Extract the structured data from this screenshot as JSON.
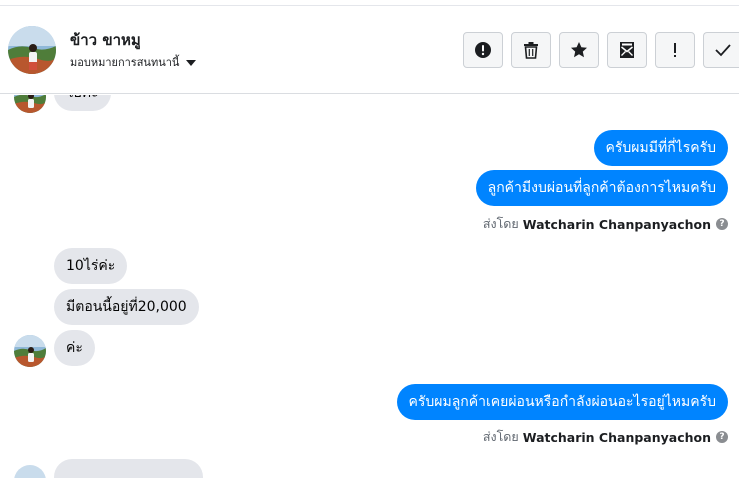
{
  "header": {
    "contact_name": "ข้าว ขาหมู",
    "assign_label": "มอบหมายการสนทนานี้"
  },
  "actions": [
    {
      "name": "mark-as-spam-button",
      "icon": "exclamation-circle-icon"
    },
    {
      "name": "delete-button",
      "icon": "trash-icon"
    },
    {
      "name": "star-button",
      "icon": "star-icon"
    },
    {
      "name": "mark-unread-button",
      "icon": "envelope-icon"
    },
    {
      "name": "follow-up-button",
      "icon": "exclamation-icon"
    },
    {
      "name": "mark-done-button",
      "icon": "checkmark-icon"
    }
  ],
  "messages": {
    "in_partial_top": "โอค่ะ",
    "out_1": "ครับผมมีที่กี่ไรครับ",
    "out_2": "ลูกค้ามีงบผ่อนที่ลูกค้าต้องการไหมครับ",
    "sent_by_label": "ส่งโดย",
    "sender_name": "Watcharin Chanpanyachon",
    "in_1": "10ไร่ค่ะ",
    "in_2": "มีตอนนี้อยู่ที่20,000",
    "in_3": "ค่ะ",
    "out_3": "ครับผมลูกค้าเคยผ่อนหรือกำลังผ่อนอะไรอยู่ไหมครับ",
    "sent_by_label_2": "ส่งโดย",
    "sender_name_2": "Watcharin Chanpanyachon"
  },
  "colors": {
    "outgoing_bubble": "#0084ff",
    "incoming_bubble": "#e4e6eb"
  }
}
